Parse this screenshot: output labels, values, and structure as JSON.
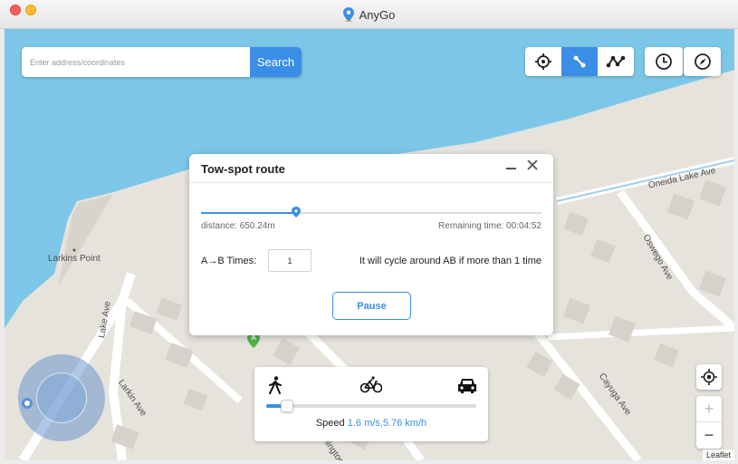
{
  "window": {
    "title": "AnyGo",
    "logo_icon": "map-pin-icon"
  },
  "search": {
    "placeholder": "Enter address/coordinates",
    "button_label": "Search"
  },
  "toolbar": {
    "modes": [
      {
        "name": "teleport",
        "icon": "crosshair-icon",
        "active": false
      },
      {
        "name": "two-spot",
        "icon": "two-spot-route-icon",
        "active": true
      },
      {
        "name": "multi-spot",
        "icon": "multi-spot-route-icon",
        "active": false
      }
    ],
    "history_icon": "clock-icon",
    "compass_icon": "compass-icon"
  },
  "dialog": {
    "title": "Tow-spot route",
    "progress": 0.28,
    "distance": "distance: 650.24m",
    "remaining": "Remaining time: 00:04:52",
    "times_label": "A→B Times:",
    "times_value": "1",
    "cycle_note": "It will cycle around AB if more than 1 time",
    "pause_label": "Pause"
  },
  "speed_panel": {
    "modes": [
      "walk-icon",
      "bike-icon",
      "car-icon"
    ],
    "slider_level": 0.1,
    "label": "Speed",
    "value": "1.6 m/s,5.76 km/h"
  },
  "map": {
    "labels": {
      "larkins_point": "Larkins Point",
      "lake_ave": "Lake Ave",
      "larkin_ave": "Larkin Ave",
      "oneida": "Oneida Lake Ave",
      "oswego": "Oswego Ave",
      "cayuga": "Cayuga Ave",
      "lington": "lington"
    },
    "marker": "A",
    "zoom_in": "+",
    "zoom_out": "−",
    "attribution": "Leaflet"
  },
  "colors": {
    "accent": "#3a8ee6",
    "water": "#7cc7e8",
    "land": "#e6e3dd"
  }
}
